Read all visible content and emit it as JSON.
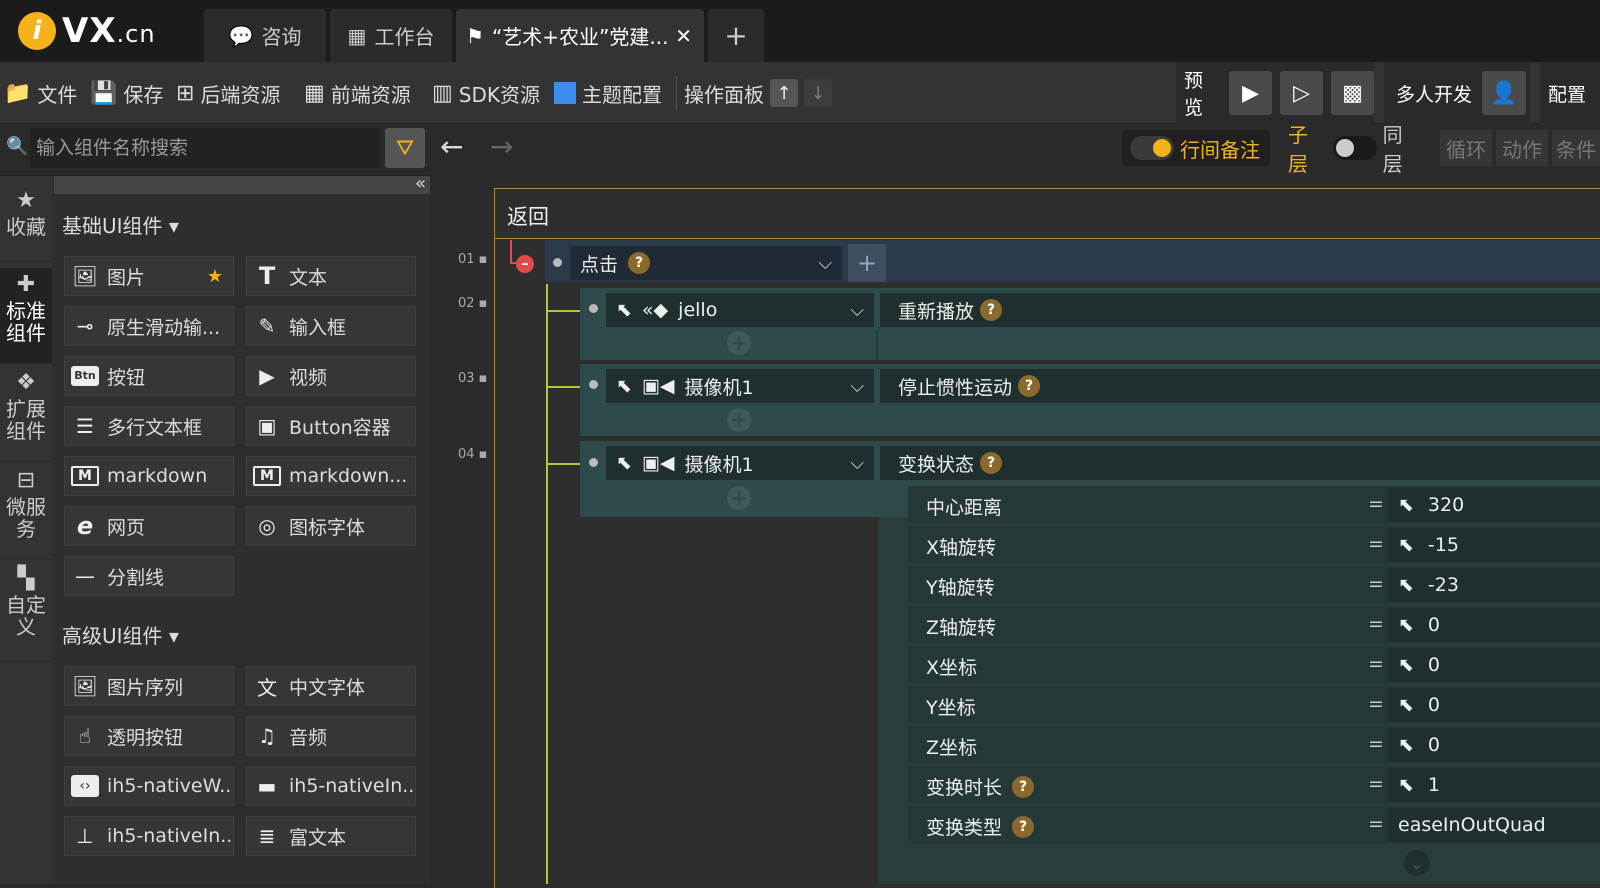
{
  "topbar": {
    "logo_text": "VX",
    "logo_suffix": ".cn",
    "tabs": [
      {
        "label": "咨询",
        "icon": "chat-icon"
      },
      {
        "label": "工作台",
        "icon": "dashboard-icon"
      },
      {
        "label": "“艺术+农业”党建...",
        "icon": "project-icon"
      }
    ],
    "add_tab": "+"
  },
  "toolbar": {
    "file": "文件",
    "save": "保存",
    "backend": "后端资源",
    "frontend": "前端资源",
    "sdk": "SDK资源",
    "theme": "主题配置",
    "panel": "操作面板",
    "preview": "预览",
    "multi_dev": "多人开发",
    "config": "配置"
  },
  "search": {
    "placeholder": "输入组件名称搜索"
  },
  "sidenav": [
    {
      "label": "收藏",
      "icon": "star-icon"
    },
    {
      "label": "标准组件",
      "icon": "puzzle-icon"
    },
    {
      "label": "扩展组件",
      "icon": "diamond-icon"
    },
    {
      "label": "微服务",
      "icon": "service-icon"
    },
    {
      "label": "自定义",
      "icon": "custom-icon"
    }
  ],
  "sections": {
    "basic": "基础UI组件 ▾",
    "advanced": "高级UI组件 ▾"
  },
  "basic_components": [
    {
      "label": "图片",
      "icon": "🖼"
    },
    {
      "label": "文本",
      "icon": "T"
    },
    {
      "label": "原生滑动输...",
      "icon": "⊸"
    },
    {
      "label": "输入框",
      "icon": "✎"
    },
    {
      "label": "按钮",
      "icon": "Btn"
    },
    {
      "label": "视频",
      "icon": "▶"
    },
    {
      "label": "多行文本框",
      "icon": "☰"
    },
    {
      "label": "Button容器",
      "icon": "▣"
    },
    {
      "label": "markdown",
      "icon": "M"
    },
    {
      "label": "markdown...",
      "icon": "M"
    },
    {
      "label": "网页",
      "icon": "e"
    },
    {
      "label": "图标字体",
      "icon": "◎"
    },
    {
      "label": "分割线",
      "icon": "—"
    }
  ],
  "advanced_components": [
    {
      "label": "图片序列",
      "icon": "🖼"
    },
    {
      "label": "中文字体",
      "icon": "文"
    },
    {
      "label": "透明按钮",
      "icon": "☝"
    },
    {
      "label": "音频",
      "icon": "♫"
    },
    {
      "label": "ih5-nativeW...",
      "icon": "‹›"
    },
    {
      "label": "ih5-nativeIn...",
      "icon": "▬"
    },
    {
      "label": "ih5-nativeIn...",
      "icon": "⊥"
    },
    {
      "label": "富文本",
      "icon": "≣"
    }
  ],
  "workarea": {
    "note_toggle": "行间备注",
    "child_layer": "子层",
    "same_layer": "同层",
    "loop": "循环",
    "action": "动作",
    "condition": "条件",
    "back": "返回"
  },
  "events": {
    "line1": "01",
    "line2": "02",
    "line3": "03",
    "line4": "04",
    "trigger": "点击",
    "rows": [
      {
        "target": "jello",
        "action": "重新播放"
      },
      {
        "target": "摄像机1",
        "action": "停止惯性运动"
      },
      {
        "target": "摄像机1",
        "action": "变换状态"
      }
    ],
    "params": [
      {
        "label": "中心距离",
        "value": "320"
      },
      {
        "label": "X轴旋转",
        "value": "-15"
      },
      {
        "label": "Y轴旋转",
        "value": "-23"
      },
      {
        "label": "Z轴旋转",
        "value": "0"
      },
      {
        "label": "X坐标",
        "value": "0"
      },
      {
        "label": "Y坐标",
        "value": "0"
      },
      {
        "label": "Z坐标",
        "value": "0"
      },
      {
        "label": "变换时长",
        "value": "1"
      },
      {
        "label": "变换类型",
        "value": "easeInOutQuad"
      }
    ],
    "eq": "="
  },
  "colors": {
    "accent": "#f5b31b",
    "line": "#b8c43a",
    "teal": "#2e4a4a"
  }
}
